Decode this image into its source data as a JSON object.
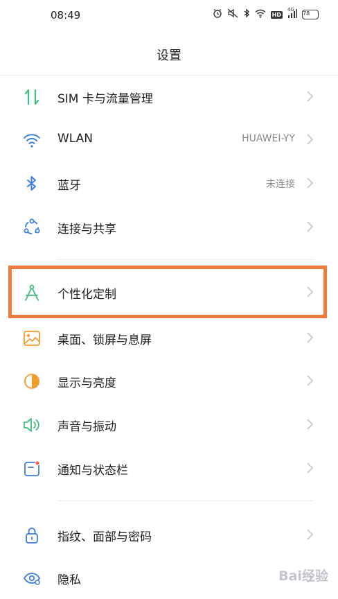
{
  "status_bar": {
    "time": "08:49",
    "icons": [
      "alarm-icon",
      "mute-icon",
      "bluetooth-icon",
      "wifi-icon",
      "hd-icon",
      "signal-icon",
      "battery-icon"
    ],
    "hd_label": "HD",
    "signal_label": "4G",
    "battery": "78"
  },
  "header": {
    "title": "设置"
  },
  "colors": {
    "highlight": "#f17a3f",
    "green": "#3fbf7f",
    "blue": "#3b7fe0",
    "orange": "#f39c2e"
  },
  "settings": {
    "sim": {
      "label": "SIM 卡与流量管理",
      "icon": "sim-data-icon"
    },
    "wlan": {
      "label": "WLAN",
      "value": "HUAWEI-YY",
      "icon": "wifi-icon"
    },
    "bluetooth": {
      "label": "蓝牙",
      "value": "未连接",
      "icon": "bluetooth-icon"
    },
    "connect": {
      "label": "连接与共享",
      "icon": "share-icon"
    },
    "personal": {
      "label": "个性化定制",
      "icon": "compass-icon"
    },
    "desktop": {
      "label": "桌面、锁屏与息屏",
      "icon": "wallpaper-icon"
    },
    "display": {
      "label": "显示与亮度",
      "icon": "brightness-icon"
    },
    "sound": {
      "label": "声音与振动",
      "icon": "speaker-icon"
    },
    "notify": {
      "label": "通知与状态栏",
      "icon": "notification-icon"
    },
    "security": {
      "label": "指纹、面部与密码",
      "icon": "lock-icon"
    },
    "privacy": {
      "label": "隐私",
      "icon": "eye-icon"
    }
  },
  "watermark": "Bai经验"
}
